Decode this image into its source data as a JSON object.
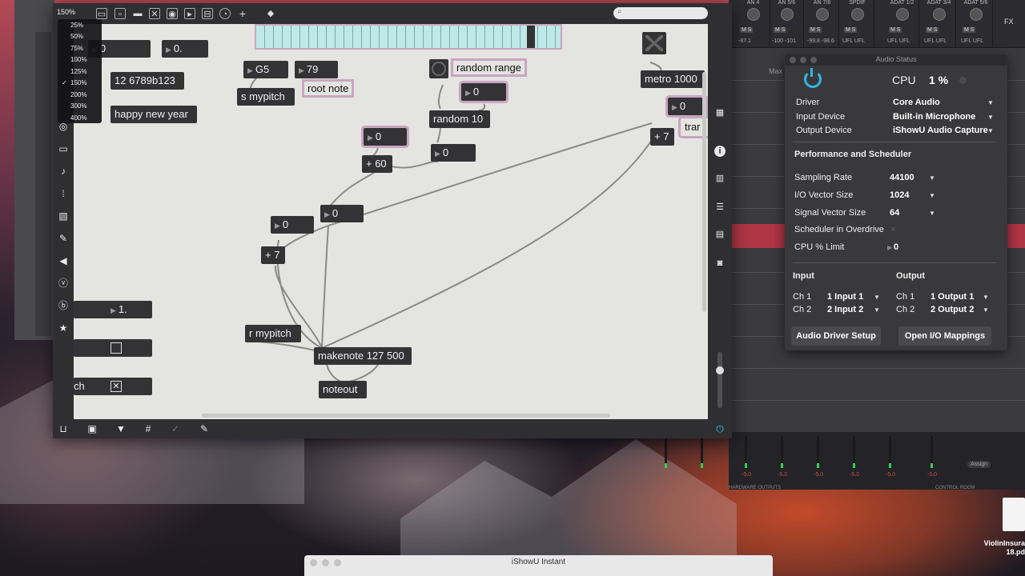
{
  "zoom": {
    "current": "150%",
    "options": [
      "25%",
      "50%",
      "75%",
      "100%",
      "125%",
      "150%",
      "200%",
      "300%",
      "400%"
    ],
    "checked": "150%"
  },
  "patch": {
    "objects": {
      "num_top_left": "0",
      "float_top": "0.",
      "msg_numbers": "12 6789b123",
      "msg_happy": "happy new year",
      "num_g5": "G5",
      "num_79": "79",
      "send_mypitch": "s mypitch",
      "random_10": "random 10",
      "num_random_out": "0",
      "num_random_range": "0",
      "num_60_in": "0",
      "plus_60": "+ 60",
      "num_plus_out": "0",
      "num_mid": "0",
      "num_left": "0",
      "plus_7_left": "+ 7",
      "metro": "metro 1000",
      "num_right": "0",
      "plus_7_right": "+ 7",
      "trans_partial": "trar",
      "recv_mypitch": "r mypitch",
      "makenote": "makenote 127 500",
      "noteout": "noteout",
      "float_left": "1.",
      "label_partial": "ch"
    },
    "comments": {
      "root_note": "root note",
      "random_range": "random range"
    }
  },
  "audio_status": {
    "title": "Audio Status",
    "cpu_label": "CPU",
    "cpu_value": "1 %",
    "driver_label": "Driver",
    "driver_value": "Core Audio",
    "input_device_label": "Input Device",
    "input_device_value": "Built-in Microphone",
    "output_device_label": "Output Device",
    "output_device_value": "iShowU Audio Capture",
    "perf_heading": "Performance and Scheduler",
    "sampling_label": "Sampling Rate",
    "sampling_value": "44100",
    "iovec_label": "I/O Vector Size",
    "iovec_value": "1024",
    "sigvec_label": "Signal Vector Size",
    "sigvec_value": "64",
    "overdrive_label": "Scheduler in Overdrive",
    "cpulimit_label": "CPU % Limit",
    "cpulimit_value": "0",
    "input_heading": "Input",
    "output_heading": "Output",
    "in_ch1_label": "Ch 1",
    "in_ch1_value": "1 Input 1",
    "in_ch2_label": "Ch 2",
    "in_ch2_value": "2 Input 2",
    "out_ch1_label": "Ch 1",
    "out_ch1_value": "1 Output 1",
    "out_ch2_label": "Ch 2",
    "out_ch2_value": "2 Output 2",
    "driver_setup_btn": "Audio Driver Setup",
    "io_mappings_btn": "Open I/O Mappings",
    "accent_color": "#2fb8e8"
  },
  "daw": {
    "strip_labels": [
      "AN 4",
      "AN 5/6",
      "AN 7/8",
      "SPDIF",
      "ADAT 1/2",
      "ADAT 3/4",
      "ADAT 5/6"
    ],
    "strip_values": [
      "-87.1",
      "-100 -101",
      "-99.8 -98.6",
      "UFL UFL",
      "UFL UFL",
      "UFL UFL",
      "UFL UFL"
    ],
    "fx_label": "FX",
    "meter_db": "-5.0",
    "hardware_outputs": "HARDWARE OUTPUTS",
    "control_room": "CONTROL ROOM",
    "assign": "Assign",
    "max_label": "Max"
  },
  "desktop": {
    "finder_title": "iShowU Instant",
    "pdf_label": "ViolinInsura 18.pd"
  }
}
